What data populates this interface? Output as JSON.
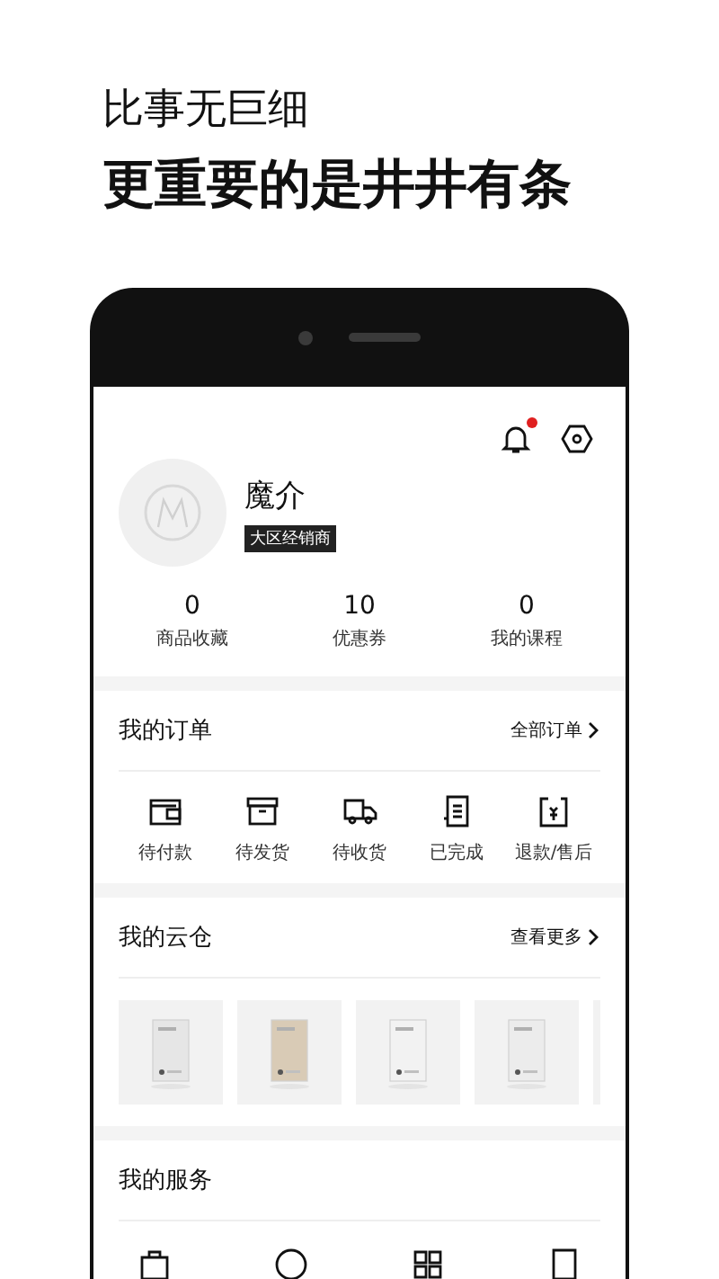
{
  "headline": {
    "line_1": "比事无巨细",
    "line_2": "更重要的是井井有条"
  },
  "profile": {
    "notification_badge": true,
    "name": "魔介",
    "role_badge": "大区经销商",
    "stats": [
      {
        "value": "0",
        "label": "商品收藏"
      },
      {
        "value": "10",
        "label": "优惠券"
      },
      {
        "value": "0",
        "label": "我的课程"
      }
    ]
  },
  "orders": {
    "title": "我的订单",
    "link": "全部订单",
    "items": [
      {
        "kind": "wallet",
        "label": "待付款"
      },
      {
        "kind": "box",
        "label": "待发货"
      },
      {
        "kind": "truck",
        "label": "待收货"
      },
      {
        "kind": "receipt",
        "label": "已完成"
      },
      {
        "kind": "refund",
        "label": "退款/售后"
      }
    ]
  },
  "cloud_warehouse": {
    "title": "我的云仓",
    "link": "查看更多"
  },
  "services": {
    "title": "我的服务"
  }
}
